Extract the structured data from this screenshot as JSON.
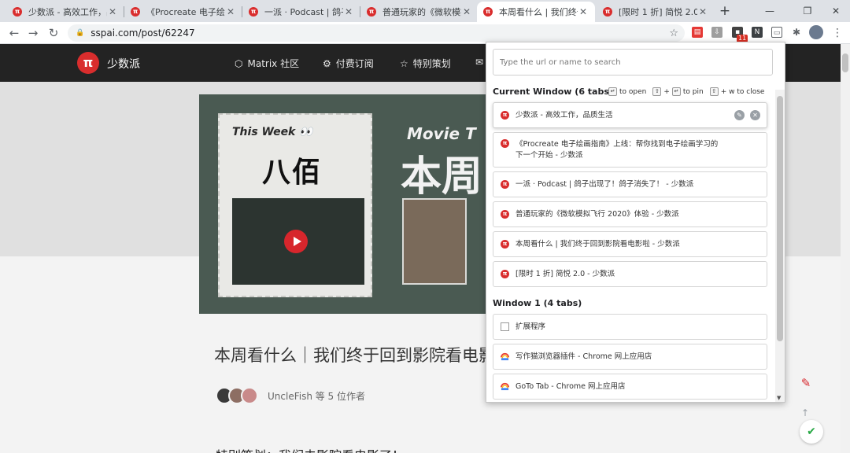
{
  "tabs": [
    {
      "title": "少数派 - 高效工作，品质生活",
      "active": false
    },
    {
      "title": "《Procreate 电子绘画指南》上线",
      "active": false
    },
    {
      "title": "一派 · Podcast | 鸽子出现了！鸽子消失了！",
      "active": false
    },
    {
      "title": "普通玩家的《微软模拟飞行 2020》体验",
      "active": false
    },
    {
      "title": "本周看什么 | 我们终于回到影院看电影啦",
      "active": true
    },
    {
      "title": "[限时 1 折] 简悦 2.0 - 少数派",
      "active": false
    }
  ],
  "toolbar": {
    "url": "sspai.com/post/62247",
    "badge": "11"
  },
  "site": {
    "logo_glyph": "π",
    "name": "少数派",
    "nav": [
      "Matrix 社区",
      "付费订阅",
      "特别策划"
    ]
  },
  "banner": {
    "this_week": "This Week 👀",
    "big": "八佰",
    "movie": "Movie T",
    "big2": "本周"
  },
  "article": {
    "title": "本周看什么｜我们终于回到影院看电影啦",
    "authors": "UncleFish 等 5 位作者",
    "next": "特别策划：我们去影院看电影了！"
  },
  "popup": {
    "search_placeholder": "Type the url or name to search",
    "current_window_label": "Current Window (6 tabs)",
    "hint_open": "to open",
    "hint_pin": "to pin",
    "hint_close": "+ w to close",
    "current_tabs": [
      "少数派 - 高效工作，品质生活",
      "《Procreate 电子绘画指南》上线：帮你找到电子绘画学习的下一个开始 - 少数派",
      "一派 · Podcast | 鸽子出现了！鸽子消失了！ - 少数派",
      "普通玩家的《微软模拟飞行 2020》体验 - 少数派",
      "本周看什么 | 我们终于回到影院看电影啦 - 少数派",
      "[限时 1 折] 简悦 2.0 - 少数派"
    ],
    "window1_label": "Window 1 (4 tabs)",
    "window1_tabs": [
      "扩展程序",
      "写作猫浏览器插件 - Chrome 网上应用店",
      "GoTo Tab - Chrome 网上应用店"
    ]
  },
  "colors": {
    "brand_red": "#d92d2d",
    "header_dark": "#232323",
    "chrome_frame": "#dee1e6"
  }
}
